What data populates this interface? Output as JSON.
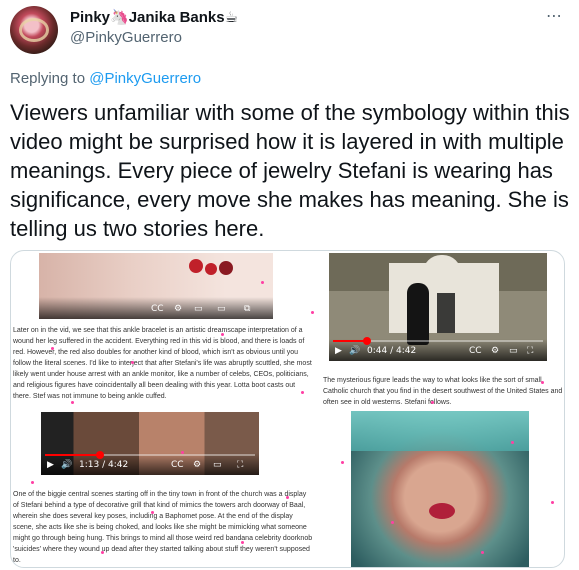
{
  "author": {
    "display_name": "Pinky🦄Janika Banks☕",
    "handle": "@PinkyGuerrero",
    "avatar_icon": "profile-avatar"
  },
  "more_icon": "⋯",
  "reply": {
    "prefix": "Replying to",
    "to": "@PinkyGuerrero"
  },
  "tweet_text": "Viewers unfamiliar with some of the symbology within this video might be surprised how it is layered in with multiple meanings. Every piece of jewelry Stefani is wearing has significance, every move she makes has meaning. She is telling us two stories here.",
  "media": {
    "shot2_time": "0:44 / 4:42",
    "shot3_time": "1:13 / 4:42",
    "progress": {
      "shot2": 0.16,
      "shot3": 0.26
    },
    "caption_1": "Later on in the vid, we see that this ankle bracelet is an artistic dreamscape interpretation of a wound her leg suffered in the accident. Everything red in this vid is blood, and there is loads of red. However, the red also doubles for another kind of blood, which isn't as obvious until you follow the literal scenes. I'd like to interject that after Stefani's life was abruptly scuttled, she most likely went under house arrest with an ankle monitor, like a number of celebs, CEOs, politicians, and religious figures have coincidentally all been dealing with this year. Lotta boot casts out there. Stef was not immune to being ankle cuffed.",
    "caption_2": "The mysterious figure leads the way to what looks like the sort of small Catholic church that you find in the desert southwest of the United States and often see in old westerns. Stefani follows.",
    "caption_3": "One of the biggie central scenes starting off in the tiny town in front of the church was a display of Stefani behind a type of decorative grill that kind of mimics the towers arch doorway of Baal, wherein she does several key poses, including a Baphomet pose. At the end of the display scene, she acts like she is being choked, and looks like she might be mimicking what someone might go through being hung. This brings to mind all those weird red bandana celebrity doorknob 'suicides' where they wound up dead after they started talking about stuff they weren't supposed to."
  },
  "colors": {
    "link": "#1d9bf0",
    "secondary_text": "#536471",
    "primary_text": "#0f1419",
    "sparkle": "#ff3fa4"
  }
}
